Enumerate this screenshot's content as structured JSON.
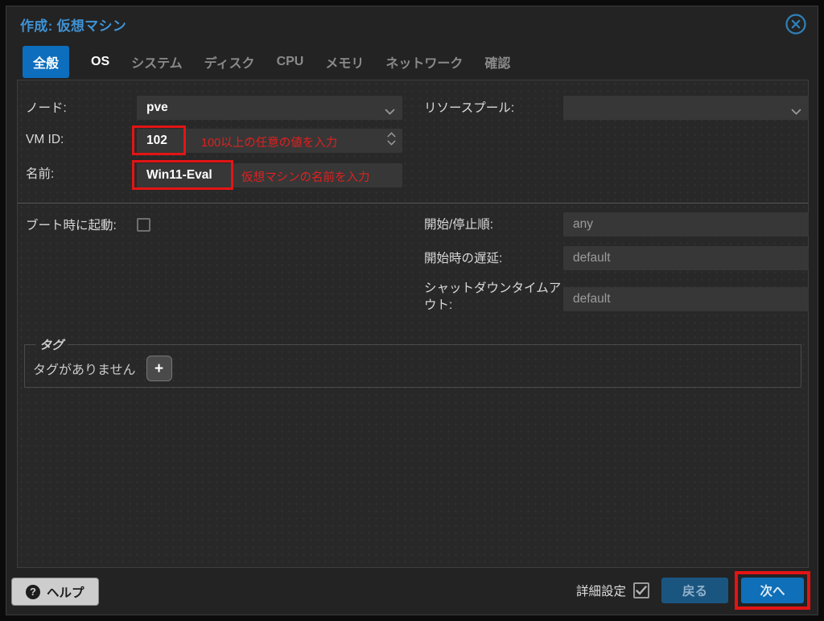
{
  "window": {
    "title": "作成: 仮想マシン"
  },
  "tabs": [
    {
      "label": "全般"
    },
    {
      "label": "OS"
    },
    {
      "label": "システム"
    },
    {
      "label": "ディスク"
    },
    {
      "label": "CPU"
    },
    {
      "label": "メモリ"
    },
    {
      "label": "ネットワーク"
    },
    {
      "label": "確認"
    }
  ],
  "form": {
    "node": {
      "label": "ノード:",
      "value": "pve"
    },
    "vmid": {
      "label": "VM ID:",
      "value": "102",
      "hint": "100以上の任意の値を入力"
    },
    "name": {
      "label": "名前:",
      "value": "Win11-Eval",
      "hint": "仮想マシンの名前を入力"
    },
    "resource_pool": {
      "label": "リソースプール:",
      "value": ""
    },
    "start_at_boot": {
      "label": "ブート時に起動:",
      "checked": false
    },
    "start_stop_order": {
      "label": "開始/停止順:",
      "placeholder": "any"
    },
    "startup_delay": {
      "label": "開始時の遅延:",
      "placeholder": "default"
    },
    "shutdown_timeout": {
      "label": "シャットダウンタイムアウト:",
      "placeholder": "default"
    }
  },
  "tags": {
    "legend": "タグ",
    "empty_text": "タグがありません",
    "add_label": "+"
  },
  "footer": {
    "help": "ヘルプ",
    "help_icon_glyph": "?",
    "advanced": "詳細設定",
    "advanced_checked": true,
    "back": "戻る",
    "next": "次へ"
  },
  "colors": {
    "accent_blue": "#0f6fb8",
    "active_tab_blue": "#0d6ebd",
    "title_blue": "#3f92d4",
    "annotation_red": "#e41414",
    "panel_bg": "#282828",
    "dialog_bg": "#232323"
  },
  "icons": {
    "close": "circle-x",
    "combo": "chevron-down",
    "vmid_spinner": "chevron-up-down",
    "help": "question-circle",
    "add_tag": "plus"
  }
}
